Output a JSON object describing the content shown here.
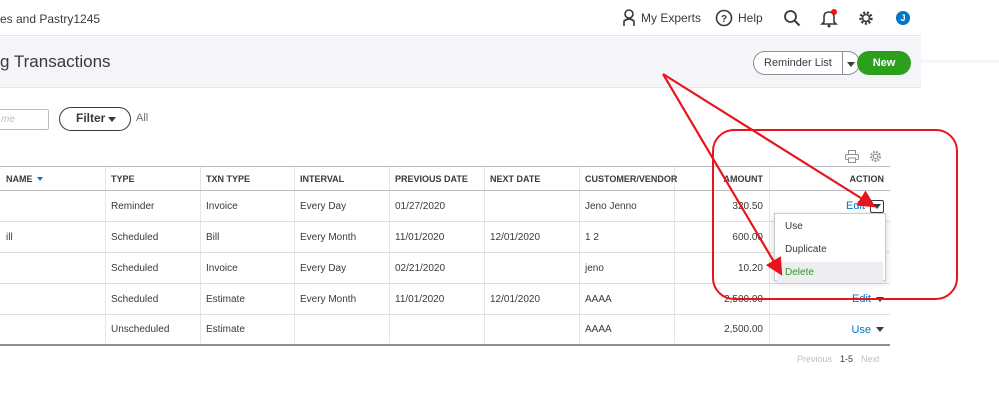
{
  "topbar": {
    "company_name": "es and Pastry1245",
    "my_experts": "My Experts",
    "help": "Help",
    "avatar_initial": "J"
  },
  "header": {
    "title": "g Transactions",
    "reminder_list": "Reminder List",
    "new_button": "New"
  },
  "filters": {
    "name_placeholder": "me",
    "filter_label": "Filter",
    "filter_value": "All"
  },
  "table": {
    "columns": {
      "name": "NAME",
      "type": "TYPE",
      "txn_type": "TXN TYPE",
      "interval": "INTERVAL",
      "previous_date": "PREVIOUS DATE",
      "next_date": "NEXT DATE",
      "customer_vendor": "CUSTOMER/VENDOR",
      "amount": "AMOUNT",
      "action": "ACTION"
    },
    "rows": [
      {
        "name": "",
        "type": "Reminder",
        "txn_type": "Invoice",
        "interval": "Every Day",
        "previous_date": "01/27/2020",
        "next_date": "",
        "customer": "Jeno Jenno",
        "amount": "320.50",
        "action": "Edit"
      },
      {
        "name": "ill",
        "type": "Scheduled",
        "txn_type": "Bill",
        "interval": "Every Month",
        "previous_date": "11/01/2020",
        "next_date": "12/01/2020",
        "customer": "1 2",
        "amount": "600.00",
        "action": ""
      },
      {
        "name": "",
        "type": "Scheduled",
        "txn_type": "Invoice",
        "interval": "Every Day",
        "previous_date": "02/21/2020",
        "next_date": "",
        "customer": "jeno",
        "amount": "10.20",
        "action": ""
      },
      {
        "name": "",
        "type": "Scheduled",
        "txn_type": "Estimate",
        "interval": "Every Month",
        "previous_date": "11/01/2020",
        "next_date": "12/01/2020",
        "customer": "AAAA",
        "amount": "2,500.00",
        "action": "Edit"
      },
      {
        "name": "",
        "type": "Unscheduled",
        "txn_type": "Estimate",
        "interval": "",
        "previous_date": "",
        "next_date": "",
        "customer": "AAAA",
        "amount": "2,500.00",
        "action": "Use"
      }
    ]
  },
  "action_menu": {
    "items": [
      "Use",
      "Duplicate",
      "Delete"
    ],
    "highlighted": "Delete"
  },
  "pagination": {
    "previous": "Previous",
    "range": "1-5",
    "next": "Next"
  },
  "colors": {
    "accent_green": "#2ca01c",
    "link_blue": "#0077c5",
    "annotation_red": "#e8141b"
  }
}
